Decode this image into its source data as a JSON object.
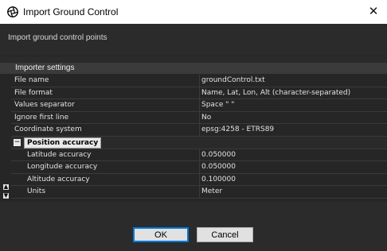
{
  "window": {
    "title": "Import Ground Control",
    "close_glyph": "✕"
  },
  "description": "Import ground control points",
  "section": {
    "header": "Importer settings"
  },
  "properties": [
    {
      "key": "File name",
      "value": "groundControl.txt"
    },
    {
      "key": "File format",
      "value": "Name, Lat, Lon, Alt (character-separated)"
    },
    {
      "key": "Values separator",
      "value": "Space \" \""
    },
    {
      "key": "Ignore first line",
      "value": "No"
    },
    {
      "key": "Coordinate system",
      "value": "epsg:4258 - ETRS89"
    }
  ],
  "group": {
    "label": "Position accuracy",
    "toggle_glyph": "−",
    "items": [
      {
        "key": "Latitude accuracy",
        "value": "0.050000"
      },
      {
        "key": "Longitude accuracy",
        "value": "0.050000"
      },
      {
        "key": "Altitude accuracy",
        "value": "0.100000"
      },
      {
        "key": "Units",
        "value": "Meter"
      }
    ]
  },
  "buttons": {
    "ok": "OK",
    "cancel": "Cancel"
  },
  "icons": {
    "app": "aperture-icon",
    "close": "close-icon",
    "scroll_up": "arrow-up-icon",
    "scroll_down": "arrow-down-icon"
  },
  "colors": {
    "accent": "#0078d7"
  }
}
